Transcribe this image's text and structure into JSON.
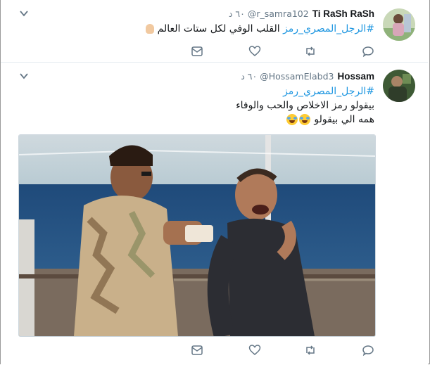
{
  "tweets": [
    {
      "name": "Ti RaSh RaSh",
      "handle": "@r_samra102",
      "time": "٦٠ د",
      "hashtag": "#الرجل_المصري_رمز",
      "line1": "القلب الوفي لكل ستات العالم",
      "line2": "",
      "line3": "",
      "emoji": "hand-icon"
    },
    {
      "name": "Hossam",
      "handle": "@HossamElabd3",
      "time": "٦٠ د",
      "hashtag": "#الرجل_المصري_رمز",
      "line1": "بيقولو رمز الاخلاص والحب والوفاء",
      "line2": "همه الي بيقولو",
      "emoji": "laughing-emoji"
    }
  ],
  "actions": [
    "reply-icon",
    "retweet-icon",
    "like-icon",
    "message-icon"
  ],
  "colors": {
    "link": "#1b95e0",
    "secondary": "#657786",
    "icon": "#657786"
  }
}
